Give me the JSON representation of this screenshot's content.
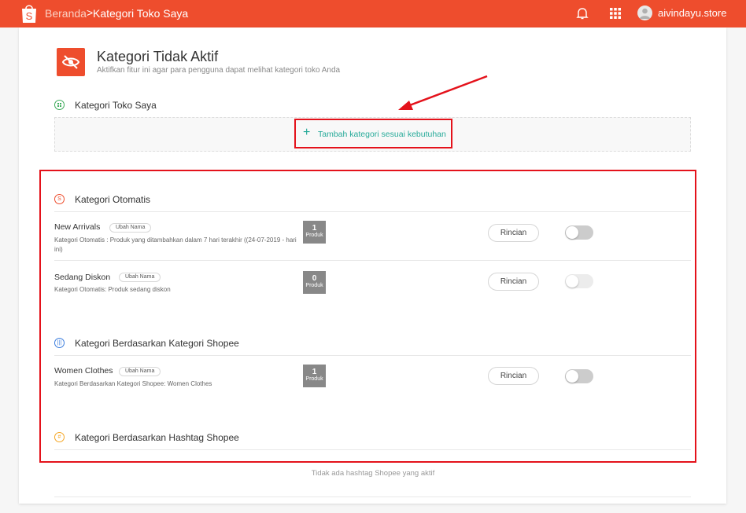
{
  "header": {
    "home": "Beranda",
    "separator": ">",
    "current": "Kategori Toko Saya",
    "username": "aivindayu.store",
    "icons": [
      "shopee-bag-icon",
      "bell-icon",
      "apps-grid-icon",
      "user-avatar-icon"
    ]
  },
  "page": {
    "title": "Kategori Tidak Aktif",
    "subtitle": "Aktifkan fitur ini agar para pengguna dapat melihat kategori toko Anda"
  },
  "my_categories": {
    "title": "Kategori Toko Saya",
    "add_label": "Tambah kategori sesuai kebutuhan"
  },
  "auto": {
    "title": "Kategori Otomatis",
    "rows": [
      {
        "name": "New Arrivals",
        "rename": "Ubah Nama",
        "desc": "Kategori Otomatis : Produk yang ditambahkan dalam 7 hari terakhir ((24-07-2019 - hari ini)",
        "count": "1",
        "count_label": "Produk",
        "rincian": "Rincian",
        "toggle_on": false
      },
      {
        "name": "Sedang Diskon",
        "rename": "Ubah Nama",
        "desc": "Kategori Otomatis: Produk sedang diskon",
        "count": "0",
        "count_label": "Produk",
        "rincian": "Rincian",
        "toggle_on": false
      }
    ]
  },
  "shopee_cat": {
    "title": "Kategori Berdasarkan Kategori Shopee",
    "rows": [
      {
        "name": "Women Clothes",
        "rename": "Ubah Nama",
        "desc": "Kategori Berdasarkan Kategori Shopee: Women Clothes",
        "count": "1",
        "count_label": "Produk",
        "rincian": "Rincian",
        "toggle_on": false
      }
    ]
  },
  "hashtag": {
    "title": "Kategori Berdasarkan Hashtag Shopee",
    "empty": "Tidak ada hashtag Shopee yang aktif"
  },
  "colors": {
    "brand": "#ee4d2d",
    "accent": "#26aa99",
    "annotation": "#e4121b"
  }
}
